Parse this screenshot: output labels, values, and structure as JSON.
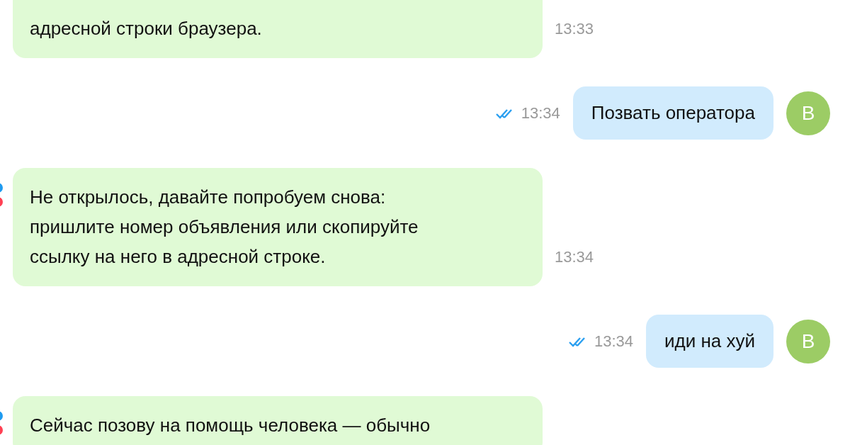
{
  "messages": [
    {
      "kind": "incoming",
      "lines": [
        "адресной строки браузера."
      ],
      "time": "13:33"
    },
    {
      "kind": "outgoing",
      "lines": [
        "Позвать оператора"
      ],
      "time": "13:34",
      "read": true,
      "avatar": "В"
    },
    {
      "kind": "incoming",
      "lines": [
        "Не открылось, давайте попробуем снова:",
        "пришлите номер объявления или скопируйте",
        "ссылку на него в адресной строке."
      ],
      "time": "13:34",
      "logo": true
    },
    {
      "kind": "outgoing",
      "lines": [
        "иди на хуй"
      ],
      "time": "13:34",
      "read": true,
      "avatar": "В"
    },
    {
      "kind": "incoming",
      "lines": [
        "Сейчас позову на помощь человека — обычно"
      ],
      "logo": true
    }
  ]
}
